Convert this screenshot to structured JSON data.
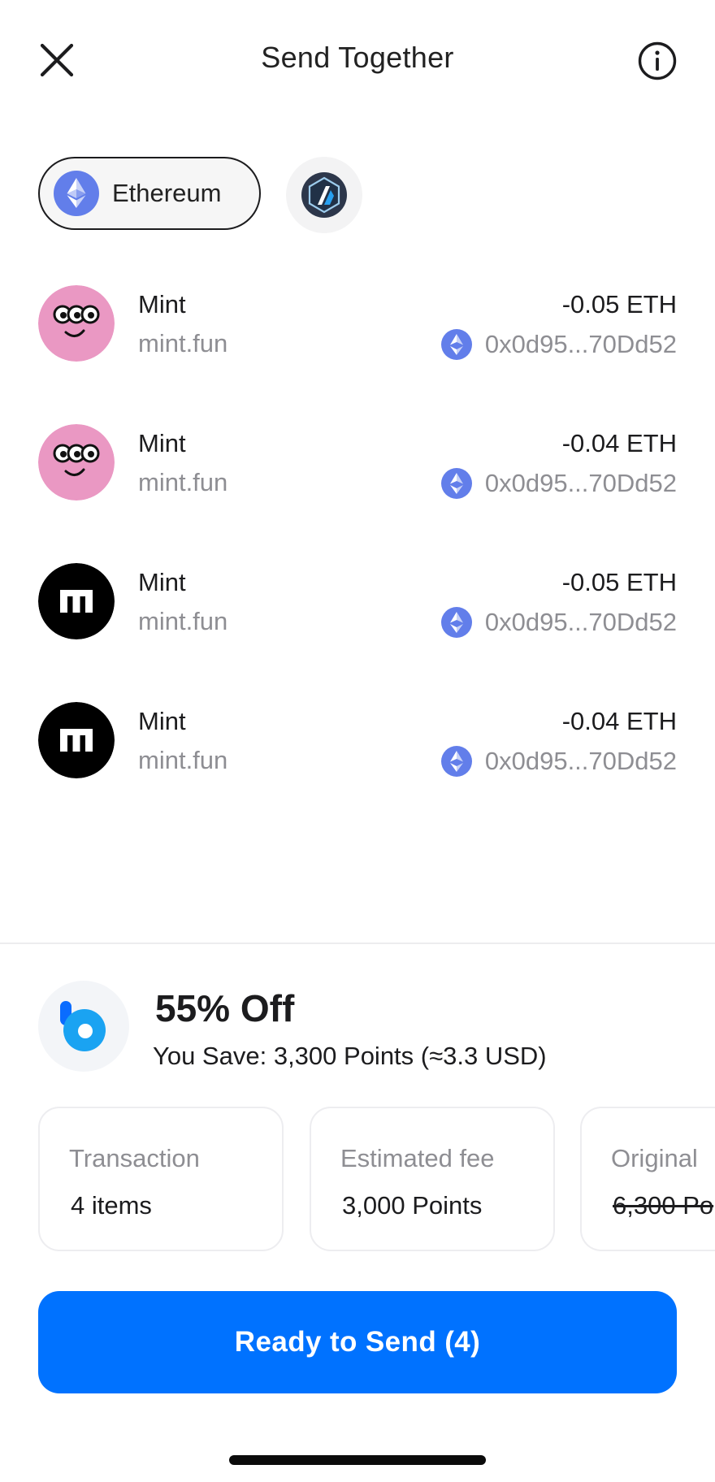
{
  "header": {
    "title": "Send Together",
    "close_icon": "close-icon",
    "info_icon": "info-icon"
  },
  "chains": {
    "selected": {
      "label": "Ethereum",
      "icon": "ethereum-icon",
      "color": "#627EEA"
    },
    "other": {
      "icon": "arbitrum-icon"
    }
  },
  "transactions": [
    {
      "name": "Mint",
      "source": "mint.fun",
      "amount": "-0.05 ETH",
      "address": "0x0d95...70Dd52",
      "avatar": "pink-face-avatar"
    },
    {
      "name": "Mint",
      "source": "mint.fun",
      "amount": "-0.04 ETH",
      "address": "0x0d95...70Dd52",
      "avatar": "pink-face-avatar"
    },
    {
      "name": "Mint",
      "source": "mint.fun",
      "amount": "-0.05 ETH",
      "address": "0x0d95...70Dd52",
      "avatar": "black-m-avatar"
    },
    {
      "name": "Mint",
      "source": "mint.fun",
      "amount": "-0.04 ETH",
      "address": "0x0d95...70Dd52",
      "avatar": "black-m-avatar"
    }
  ],
  "promo": {
    "title": "55% Off",
    "save_label": "You Save:",
    "save_value": "3,300 Points (≈3.3 USD)",
    "logo_icon": "points-logo-icon"
  },
  "summary_cards": [
    {
      "label": "Transaction",
      "value": "4 items",
      "strikethrough": false
    },
    {
      "label": "Estimated fee",
      "value": "3,000 Points",
      "strikethrough": false
    },
    {
      "label": "Original",
      "value": "6,300 Po",
      "strikethrough": true
    }
  ],
  "send_button": {
    "label": "Ready to Send (4)",
    "color": "#0072FF"
  }
}
